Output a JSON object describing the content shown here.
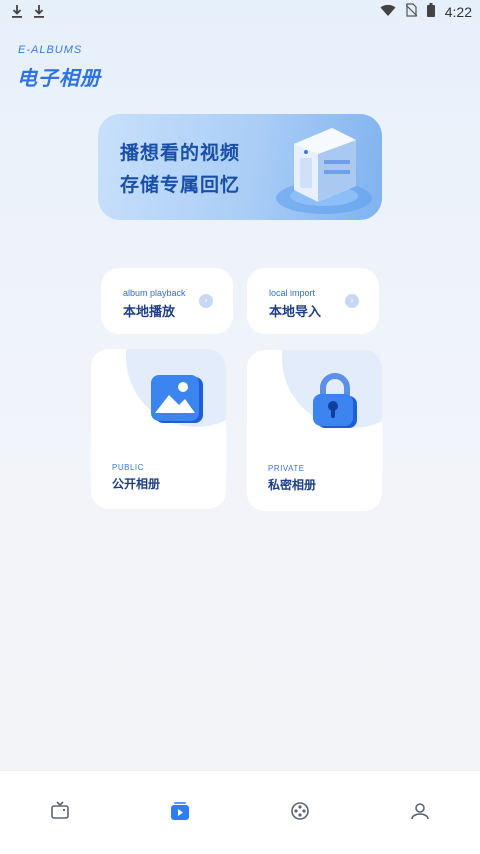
{
  "status_bar": {
    "time": "4:22",
    "left_icons": [
      "download-icon",
      "download-icon"
    ],
    "right_icons": [
      "wifi-icon",
      "no-sim-icon",
      "battery-icon"
    ]
  },
  "header": {
    "brand_en": "E-ALBUMS",
    "brand_cn": "电子相册"
  },
  "banner": {
    "line1": "播想看的视频",
    "line2": "存储专属回忆"
  },
  "quick_actions": [
    {
      "en": "album playback",
      "cn": "本地播放",
      "icon": "chevron-right-icon"
    },
    {
      "en": "local import",
      "cn": "本地导入",
      "icon": "chevron-right-icon"
    }
  ],
  "albums": [
    {
      "en": "PUBLIC",
      "cn": "公开相册",
      "icon": "image-icon"
    },
    {
      "en": "PRIVATE",
      "cn": "私密相册",
      "icon": "lock-icon"
    }
  ],
  "tab_bar": {
    "tabs": [
      {
        "icon": "tv-icon",
        "active": false
      },
      {
        "icon": "album-play-icon",
        "active": true
      },
      {
        "icon": "film-reel-icon",
        "active": false
      },
      {
        "icon": "user-icon",
        "active": false
      }
    ]
  },
  "colors": {
    "accent": "#2f72e4",
    "text_dark": "#1f3f86",
    "card_bg": "#ffffff"
  }
}
